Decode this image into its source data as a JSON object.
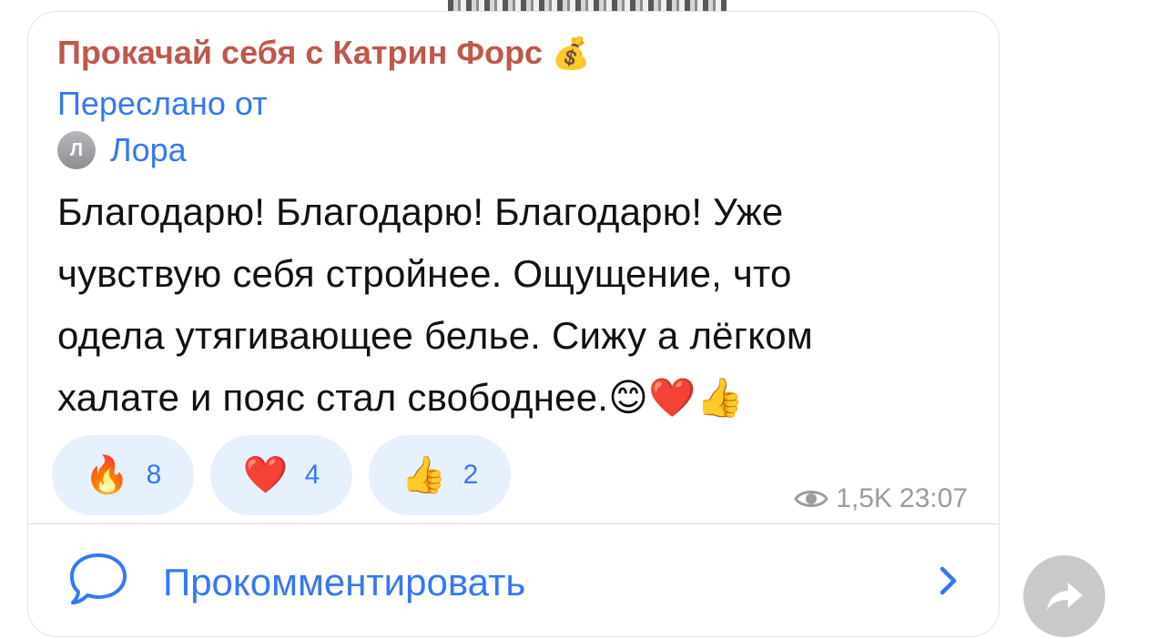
{
  "post": {
    "channel_title": "Прокачай себя с Катрин Форс",
    "channel_title_emoji": "💰",
    "forwarded_label": "Переслано от",
    "forwarded_author_initial": "Л",
    "forwarded_author": "Лора",
    "text_lines": [
      "Благодарю! Благодарю! Благодарю! Уже",
      "чувствую себя стройнее. Ощущение, что",
      "одела утягивающее белье. Сижу а лёгком",
      "халате и пояс стал свободнее."
    ],
    "text_end_emojis": "😊❤️👍",
    "reactions": [
      {
        "emoji": "🔥",
        "count": "8"
      },
      {
        "emoji": "❤️",
        "count": "4"
      },
      {
        "emoji": "👍",
        "count": "2"
      }
    ],
    "views": "1,5K",
    "time": "23:07"
  },
  "footer": {
    "comment_label": "Прокомментировать"
  },
  "icons": {
    "views": "eye-icon",
    "comment": "comment-bubble-icon",
    "chevron": "chevron-right-icon",
    "share": "share-arrow-icon"
  },
  "colors": {
    "channel_title": "#c0574b",
    "accent": "#3478f6",
    "reaction_bg": "#e7f0fd",
    "meta": "#9b9ba0",
    "share_bg": "#c9c9cc"
  }
}
